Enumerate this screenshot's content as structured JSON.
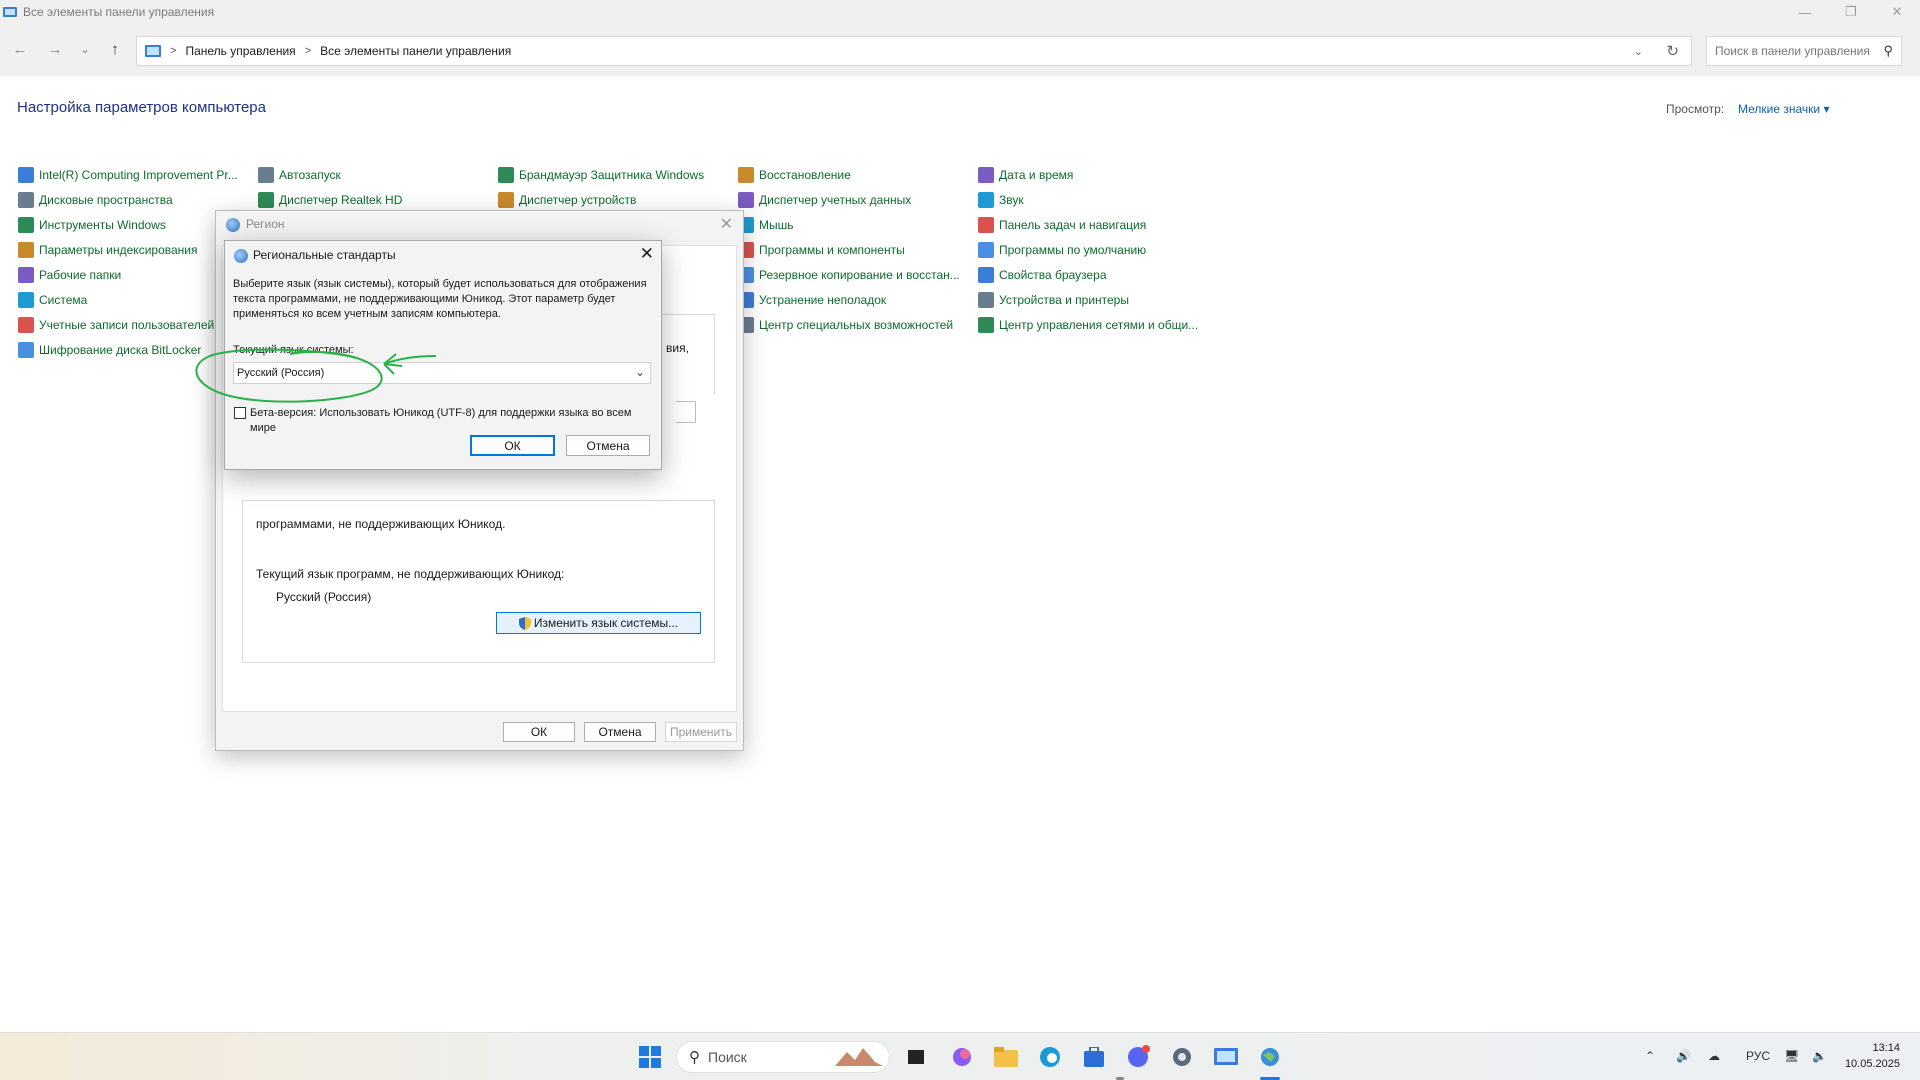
{
  "window": {
    "title": "Все элементы панели управления",
    "controls": [
      "—",
      "❐",
      "✕"
    ]
  },
  "nav": {
    "back": "←",
    "forward": "→",
    "recent": "⌄",
    "up": "↑",
    "breadcrumb": [
      "Панель управления",
      "Все элементы панели управления"
    ],
    "search_placeholder": "Поиск в панели управления"
  },
  "header": {
    "title": "Настройка параметров компьютера",
    "view_label": "Просмотр:",
    "view_value": "Мелкие значки ▾"
  },
  "items": {
    "col1": [
      "Intel(R) Computing Improvement Pr...",
      "Дисковые пространства",
      "Инструменты Windows",
      "Параметры индексирования",
      "Рабочие папки",
      "Система",
      "Учетные записи пользователей",
      "Шифрование диска BitLocker"
    ],
    "col2": [
      "Автозапуск",
      "Диспетчер Realtek HD"
    ],
    "col3": [
      "Брандмауэр Защитника Windows",
      "Диспетчер устройств"
    ],
    "col4": [
      "Восстановление",
      "Диспетчер учетных данных",
      "Мышь",
      "Программы и компоненты",
      "Резервное копирование и восстан...",
      "Устранение неполадок",
      "Центр специальных возможностей"
    ],
    "col5": [
      "Дата и время",
      "Звук",
      "Панель задач и навигация",
      "Программы по умолчанию",
      "Свойства браузера",
      "Устройства и принтеры",
      "Центр управления сетями и общи..."
    ]
  },
  "region_dialog": {
    "title": "Регион",
    "partial_text": "вия,",
    "group_partial": "программами, не поддерживающих Юникод.",
    "current_label": "Текущий язык программ, не поддерживающих Юникод:",
    "current_value": "Русский (Россия)",
    "change_button": "Изменить язык системы...",
    "ok": "ОК",
    "cancel": "Отмена",
    "apply": "Применить"
  },
  "std_dialog": {
    "title": "Региональные стандарты",
    "description": "Выберите язык (язык системы), который будет использоваться для отображения текста программами, не поддерживающими Юникод. Этот параметр будет применяться ко всем учетным записям компьютера.",
    "current_label": "Текущий язык системы:",
    "current_value": "Русский (Россия)",
    "beta_label": "Бета-версия: Использовать Юникод (UTF-8) для поддержки языка во всем мире",
    "beta_checked": false,
    "ok": "ОК",
    "cancel": "Отмена"
  },
  "taskbar": {
    "search_label": "Поиск",
    "lang": "РУС",
    "time": "13:14",
    "date": "10.05.2025"
  },
  "colors": {
    "link_green": "#0d6b30",
    "title_blue": "#1e3287",
    "accent_blue": "#0078d7",
    "annotation_green": "#2bb04a"
  }
}
